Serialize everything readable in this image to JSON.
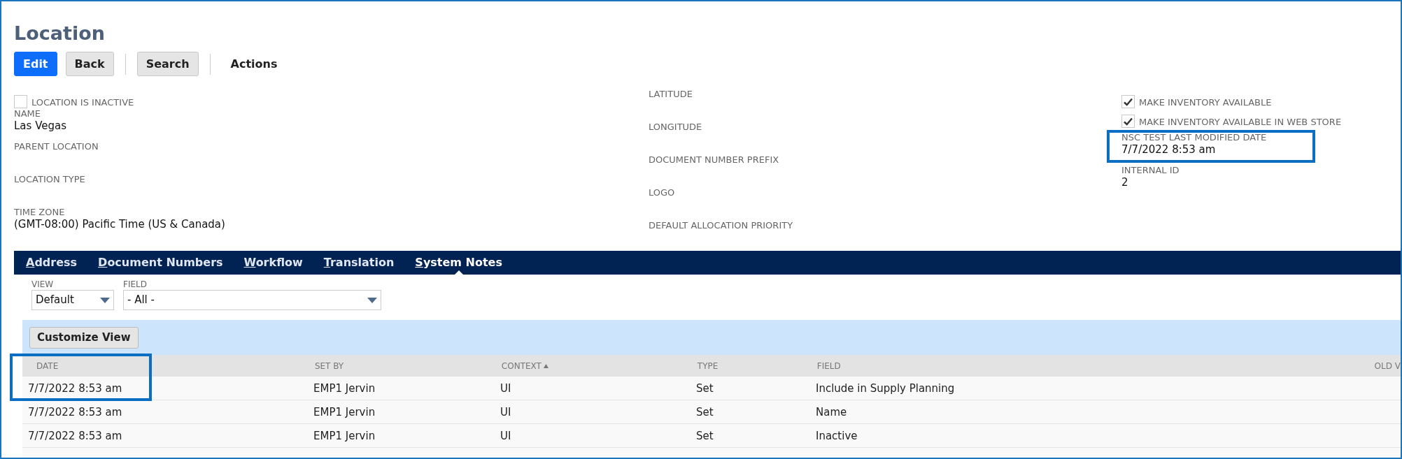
{
  "page": {
    "title": "Location"
  },
  "toolbar_groups": [
    [
      {
        "label": "Edit",
        "kind": "primary"
      },
      {
        "label": "Back",
        "kind": "secondary"
      }
    ],
    [
      {
        "label": "Search",
        "kind": "secondary"
      }
    ],
    [
      {
        "label": "Actions",
        "kind": "menu"
      }
    ]
  ],
  "field_columns": [
    [
      {
        "kind": "checkbox",
        "label": "LOCATION IS INACTIVE",
        "checked": false
      },
      {
        "kind": "field",
        "label": "NAME",
        "value": "Las Vegas"
      },
      {
        "kind": "field",
        "label": "PARENT LOCATION"
      },
      {
        "kind": "field",
        "label": "LOCATION TYPE"
      },
      {
        "kind": "field",
        "label": "TIME ZONE",
        "value": "(GMT-08:00) Pacific Time (US & Canada)"
      }
    ],
    [
      {
        "kind": "field",
        "label": "LATITUDE"
      },
      {
        "kind": "field",
        "label": "LONGITUDE"
      },
      {
        "kind": "field",
        "label": "DOCUMENT NUMBER PREFIX"
      },
      {
        "kind": "field",
        "label": "LOGO"
      },
      {
        "kind": "field",
        "label": "DEFAULT ALLOCATION PRIORITY"
      }
    ],
    [
      {
        "kind": "checkbox",
        "label": "MAKE INVENTORY AVAILABLE",
        "checked": true
      },
      {
        "kind": "checkbox",
        "label": "MAKE INVENTORY AVAILABLE IN WEB STORE",
        "checked": true
      },
      {
        "kind": "field",
        "label": "NSC TEST LAST MODIFIED DATE",
        "value": "7/7/2022 8:53 am",
        "highlighted": true
      },
      {
        "kind": "field",
        "label": "INTERNAL ID",
        "value": "2"
      }
    ]
  ],
  "tabs": [
    {
      "label": "Address",
      "selected": false
    },
    {
      "label": "Document Numbers",
      "selected": false
    },
    {
      "label": "Workflow",
      "selected": false
    },
    {
      "label": "Translation",
      "selected": false
    },
    {
      "label": "System Notes",
      "selected": true
    }
  ],
  "filters": [
    {
      "label": "VIEW",
      "value": "Default",
      "wide": false
    },
    {
      "label": "FIELD",
      "value": "- All -",
      "wide": true
    }
  ],
  "customize_button": "Customize View",
  "table": {
    "columns": [
      {
        "label": "DATE",
        "highlighted": true,
        "sorted": false
      },
      {
        "label": "SET BY",
        "sorted": false
      },
      {
        "label": "CONTEXT",
        "sorted": true
      },
      {
        "label": "TYPE",
        "sorted": false
      },
      {
        "label": "FIELD",
        "sorted": false
      },
      {
        "label": "OLD V",
        "sorted": false
      }
    ],
    "rows": [
      [
        "7/7/2022 8:53 am",
        "EMP1 Jervin",
        "UI",
        "Set",
        "Include in Supply Planning"
      ],
      [
        "7/7/2022 8:53 am",
        "EMP1 Jervin",
        "UI",
        "Set",
        "Name"
      ],
      [
        "7/7/2022 8:53 am",
        "EMP1 Jervin",
        "UI",
        "Set",
        "Inactive"
      ]
    ]
  }
}
